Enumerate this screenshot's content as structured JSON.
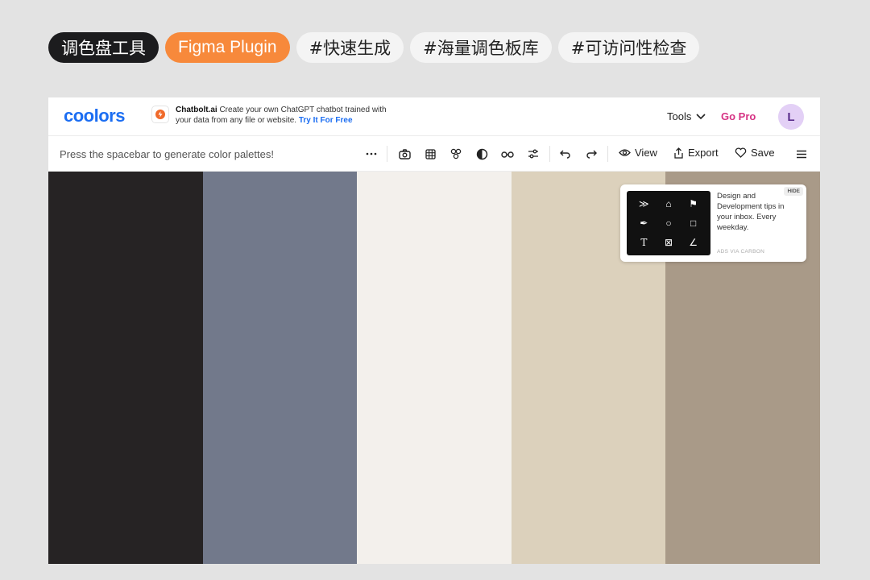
{
  "tags": [
    {
      "label": "调色盘工具",
      "style": "dark"
    },
    {
      "label": "Figma Plugin",
      "style": "orange"
    },
    {
      "label": "#快速生成",
      "style": "light"
    },
    {
      "label": "#海量调色板库",
      "style": "light"
    },
    {
      "label": "#可访问性检查",
      "style": "light"
    }
  ],
  "header": {
    "logo": "coolors",
    "ad": {
      "brand": "Chatbolt.ai",
      "text": "Create your own ChatGPT chatbot trained with your data from any file or website.",
      "link": "Try It For Free"
    },
    "tools": "Tools",
    "gopro": "Go Pro",
    "avatar": "L"
  },
  "toolbar": {
    "hint": "Press the spacebar to generate color palettes!",
    "view": "View",
    "export": "Export",
    "save": "Save"
  },
  "palette": {
    "colors": [
      "#262324",
      "#72798b",
      "#f3f0ec",
      "#dcd1bc",
      "#a99a88"
    ]
  },
  "carbon": {
    "text": "Design and Development tips in your inbox. Every weekday.",
    "via": "ADS VIA CARBON",
    "hide": "HIDE"
  },
  "colors": {
    "accent": "#1c6ef2",
    "gopro": "#d63384",
    "figma_tag": "#f7893b"
  }
}
